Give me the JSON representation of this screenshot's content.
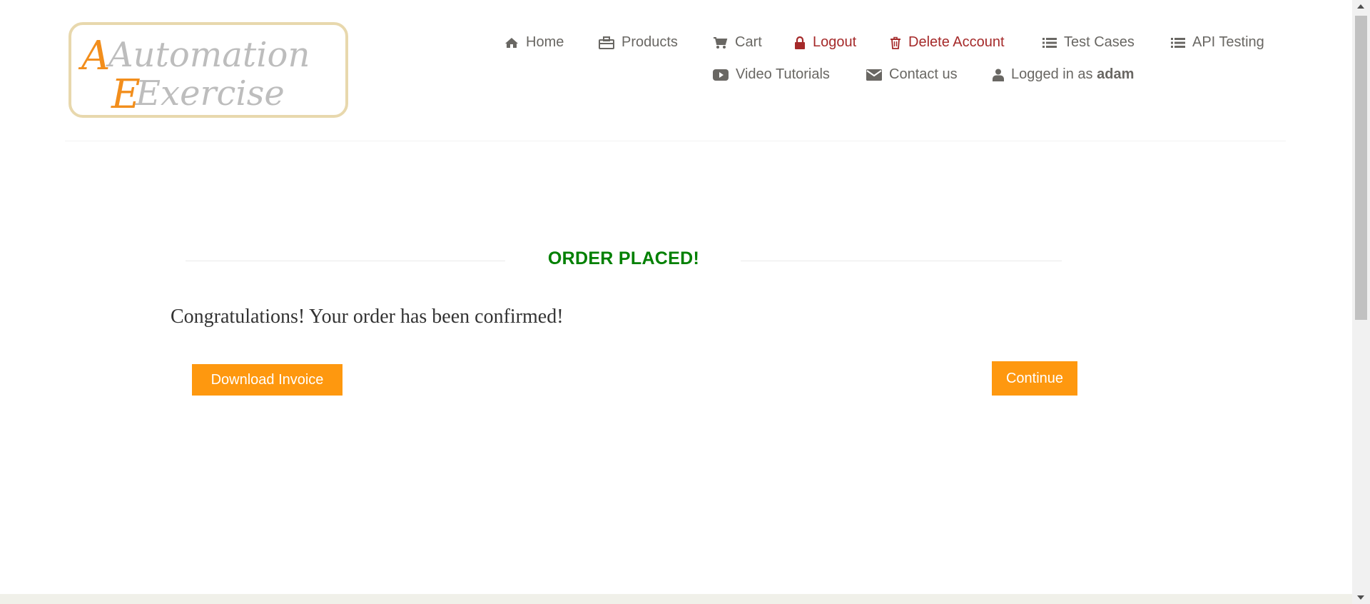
{
  "logo": {
    "line1": "Automation",
    "line2": "Exercise"
  },
  "nav": {
    "home": {
      "label": "Home",
      "icon": "home-icon"
    },
    "products": {
      "label": "Products",
      "icon": "briefcase-icon"
    },
    "cart": {
      "label": "Cart",
      "icon": "shopping-cart-icon"
    },
    "logout": {
      "label": "Logout",
      "icon": "lock-icon"
    },
    "delete_account": {
      "label": "Delete Account",
      "icon": "trash-icon"
    },
    "test_cases": {
      "label": "Test Cases",
      "icon": "list-icon"
    },
    "api_testing": {
      "label": "API Testing",
      "icon": "list-icon"
    },
    "video_tutorials": {
      "label": "Video Tutorials",
      "icon": "youtube-play-icon"
    },
    "contact_us": {
      "label": "Contact us",
      "icon": "envelope-icon"
    },
    "logged_in_prefix": "Logged in as",
    "logged_in_user": "adam"
  },
  "order": {
    "title": "ORDER PLACED!",
    "message": "Congratulations! Your order has been confirmed!",
    "download_label": "Download Invoice",
    "continue_label": "Continue"
  },
  "colors": {
    "accent": "#fe980f",
    "success_title": "#008000",
    "danger_links": "#a52a2a",
    "nav_text": "#696763"
  }
}
